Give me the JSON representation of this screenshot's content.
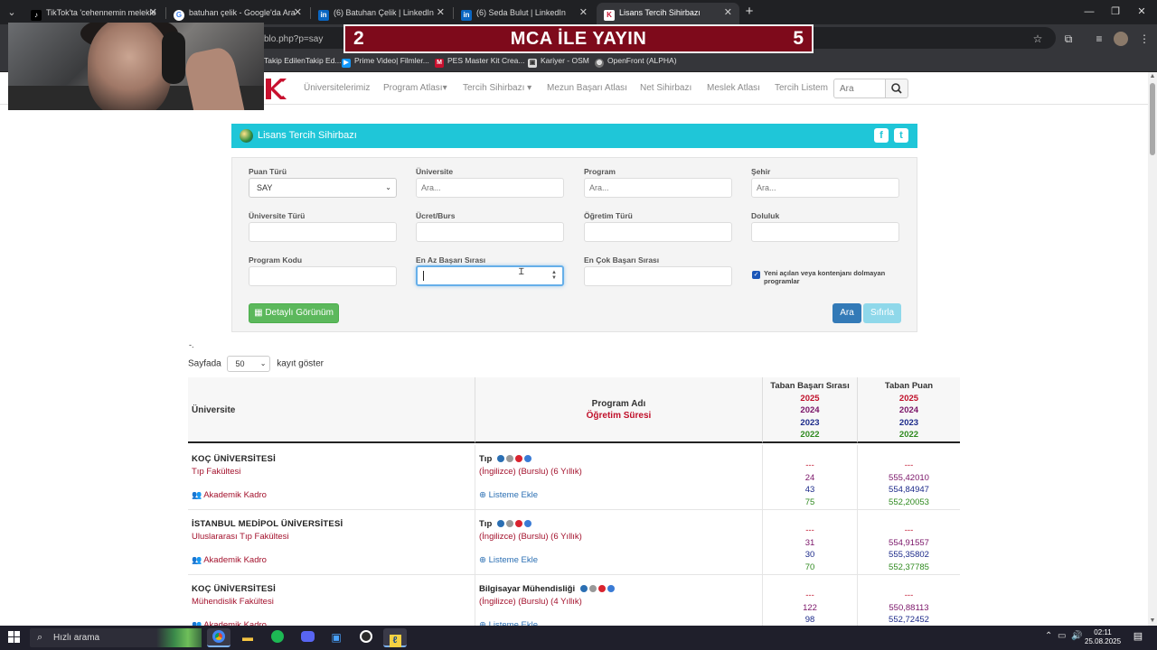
{
  "browser": {
    "tabs": [
      {
        "title": "TikTok'ta 'cehennemin melekler'",
        "favicon": "tiktok-icon",
        "active": false
      },
      {
        "title": "batuhan çelik - Google'da Ara",
        "favicon": "google-icon",
        "active": false
      },
      {
        "title": "(6) Batuhan Çelik | LinkedIn",
        "favicon": "linkedin-icon",
        "active": false
      },
      {
        "title": "(6) Seda Bulut | LinkedIn",
        "favicon": "linkedin-icon",
        "active": false
      },
      {
        "title": "Lisans Tercih Sihirbazı",
        "favicon": "site-logo-icon",
        "active": true
      }
    ],
    "url": "blo.php?p=say",
    "bookmarks": [
      {
        "label": "Takip EdilenTakip Ed...",
        "icon": "tiktok-icon"
      },
      {
        "label": "Prime Video| Filmler...",
        "icon": "prime-video-icon"
      },
      {
        "label": "PES Master Kit Crea...",
        "icon": "pes-master-icon"
      },
      {
        "label": "Kariyer - OSM",
        "icon": "osm-icon"
      },
      {
        "label": "OpenFront (ALPHA)",
        "icon": "globe-icon"
      }
    ]
  },
  "stream": {
    "banner_left": "2",
    "banner_title": "MCA İLE YAYIN",
    "banner_right": "5"
  },
  "nav": {
    "items": [
      "Üniversitelerimiz",
      "Program Atlası",
      "Tercih Sihirbazı",
      "Mezun Başarı Atlası",
      "Net Sihirbazı",
      "Meslek Atlası",
      "Tercih Listem"
    ],
    "search_placeholder": "Ara"
  },
  "panel": {
    "title": "Lisans Tercih Sihirbazı",
    "fields": {
      "puan_turu_label": "Puan Türü",
      "puan_turu_value": "SAY",
      "universite_label": "Üniversite",
      "universite_placeholder": "Ara...",
      "program_label": "Program",
      "program_placeholder": "Ara...",
      "sehir_label": "Şehir",
      "sehir_placeholder": "Ara...",
      "universite_turu_label": "Üniversite Türü",
      "ucret_label": "Ücret/Burs",
      "ogretim_turu_label": "Öğretim Türü",
      "doluluk_label": "Doluluk",
      "program_kodu_label": "Program Kodu",
      "en_az_label": "En Az Başarı Sırası",
      "en_cok_label": "En Çok Başarı Sırası"
    },
    "checkbox_label": "Yeni açılan veya kontenjanı dolmayan programlar",
    "detail_button": "Detaylı Görünüm",
    "search_button": "Ara",
    "reset_button": "Sıfırla"
  },
  "table": {
    "dot": "-.",
    "page_size_prefix": "Sayfada",
    "page_size_value": "50",
    "page_size_suffix": "kayıt göster",
    "headers": {
      "universite": "Üniversite",
      "program": "Program Adı",
      "ogretim": "Öğretim Süresi",
      "taban_basari": "Taban Başarı Sırası",
      "taban_puan": "Taban Puan",
      "years": [
        "2025",
        "2024",
        "2023",
        "2022"
      ]
    },
    "kadro_label": "Akademik Kadro",
    "liste_label": "Listeme Ekle",
    "rows": [
      {
        "university": "KOÇ ÜNİVERSİTESİ",
        "faculty": "Tıp Fakültesi",
        "program": "Tıp",
        "details": "(İngilizce) (Burslu) (6 Yıllık)",
        "ranks": [
          "---",
          "24",
          "43",
          "75"
        ],
        "scores": [
          "---",
          "555,42010",
          "554,84947",
          "552,20053"
        ]
      },
      {
        "university": "İSTANBUL MEDİPOL ÜNİVERSİTESİ",
        "faculty": "Uluslararası Tıp Fakültesi",
        "program": "Tıp",
        "details": "(İngilizce) (Burslu) (6 Yıllık)",
        "ranks": [
          "---",
          "31",
          "30",
          "70"
        ],
        "scores": [
          "---",
          "554,91557",
          "555,35802",
          "552,37785"
        ]
      },
      {
        "university": "KOÇ ÜNİVERSİTESİ",
        "faculty": "Mühendislik Fakültesi",
        "program": "Bilgisayar Mühendisliği",
        "details": "(İngilizce) (Burslu) (4 Yıllık)",
        "ranks": [
          "---",
          "122",
          "98",
          ""
        ],
        "scores": [
          "---",
          "550,88113",
          "552,72452",
          ""
        ]
      }
    ]
  },
  "taskbar": {
    "search_placeholder": "Hızlı arama",
    "time": "02:11",
    "date": "25.08.2025"
  }
}
